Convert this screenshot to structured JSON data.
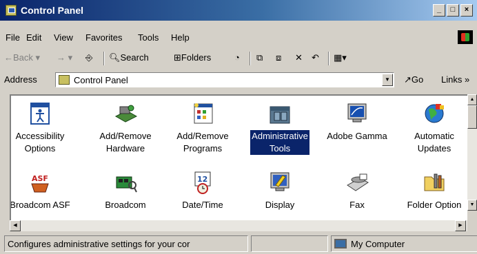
{
  "window": {
    "title": "Control Panel"
  },
  "menu": [
    {
      "label": "File"
    },
    {
      "label": "Edit"
    },
    {
      "label": "View"
    },
    {
      "label": "Favorites"
    },
    {
      "label": "Tools"
    },
    {
      "label": "Help"
    }
  ],
  "toolbar": {
    "back": "Back",
    "search": "Search",
    "folders": "Folders"
  },
  "address": {
    "label": "Address",
    "value": "Control Panel",
    "go": "Go",
    "links": "Links"
  },
  "items": [
    {
      "label": "Accessibility\nOptions",
      "icon": "accessibility-icon"
    },
    {
      "label": "Add/Remove\nHardware",
      "icon": "hardware-icon"
    },
    {
      "label": "Add/Remove\nPrograms",
      "icon": "programs-icon"
    },
    {
      "label": "Administrative\nTools",
      "icon": "admin-tools-icon",
      "selected": true
    },
    {
      "label": "Adobe Gamma",
      "icon": "monitor-icon"
    },
    {
      "label": "Automatic\nUpdates",
      "icon": "globe-icon"
    },
    {
      "label": "Broadcom ASF",
      "icon": "asf-icon"
    },
    {
      "label": "Broadcom",
      "icon": "network-card-icon"
    },
    {
      "label": "Date/Time",
      "icon": "calendar-clock-icon"
    },
    {
      "label": "Display",
      "icon": "display-icon"
    },
    {
      "label": "Fax",
      "icon": "fax-icon"
    },
    {
      "label": "Folder Option",
      "icon": "folder-options-icon"
    }
  ],
  "status": {
    "message": "Configures administrative settings for your cor",
    "zone": "My Computer"
  }
}
